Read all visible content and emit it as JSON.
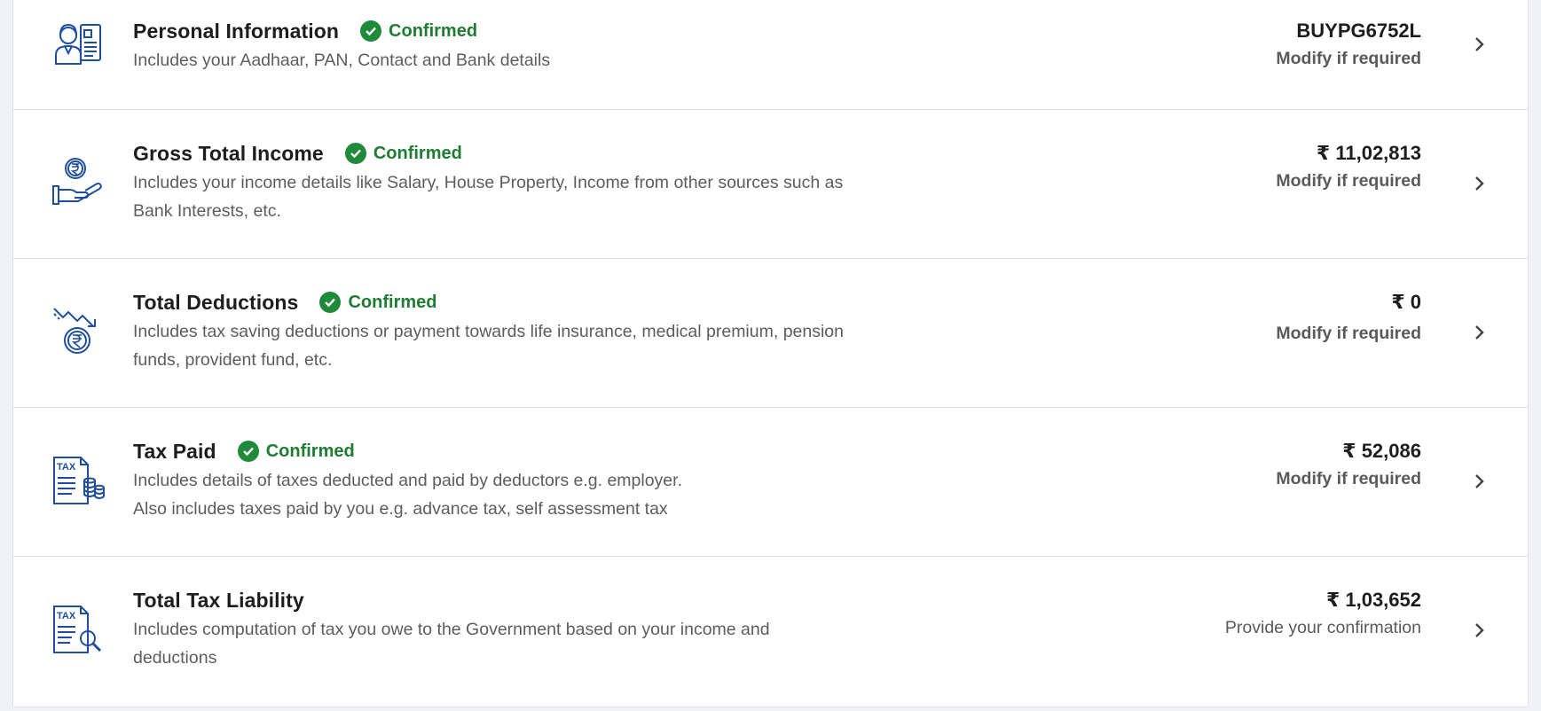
{
  "badge_label": "Confirmed",
  "colors": {
    "accent": "#1f4f9c",
    "confirmed": "#1e7d32",
    "text": "#1d1d1d",
    "muted": "#5d5d5d"
  },
  "rows": [
    {
      "title": "Personal Information",
      "confirmed": true,
      "desc1": "Includes your Aadhaar, PAN, Contact and Bank details",
      "desc2": "",
      "value": "BUYPG6752L",
      "action": "Modify if required",
      "icon": "personal-info-icon"
    },
    {
      "title": "Gross Total Income",
      "confirmed": true,
      "desc1": "Includes your income details like Salary, House Property, Income from other sources such as",
      "desc2": "Bank Interests, etc.",
      "value": "₹ 11,02,813",
      "action": "Modify if required",
      "icon": "income-hand-icon"
    },
    {
      "title": "Total Deductions",
      "confirmed": true,
      "desc1": "Includes tax saving deductions or payment towards life insurance, medical premium, pension",
      "desc2": "funds, provident fund, etc.",
      "value": "₹ 0",
      "action": "Modify if required",
      "icon": "deductions-icon"
    },
    {
      "title": "Tax Paid",
      "confirmed": true,
      "desc1": "Includes details of taxes deducted and paid by deductors e.g. employer.",
      "desc2": "Also includes taxes paid by you e.g. advance tax, self assessment tax",
      "value": "₹ 52,086",
      "action": "Modify if required",
      "icon": "tax-paid-icon"
    },
    {
      "title": "Total Tax Liability",
      "confirmed": false,
      "desc1": "Includes computation of tax you owe to the Government based on your income and",
      "desc2": "deductions",
      "value": "₹ 1,03,652",
      "action": "Provide your confirmation",
      "icon": "tax-liability-icon"
    }
  ]
}
